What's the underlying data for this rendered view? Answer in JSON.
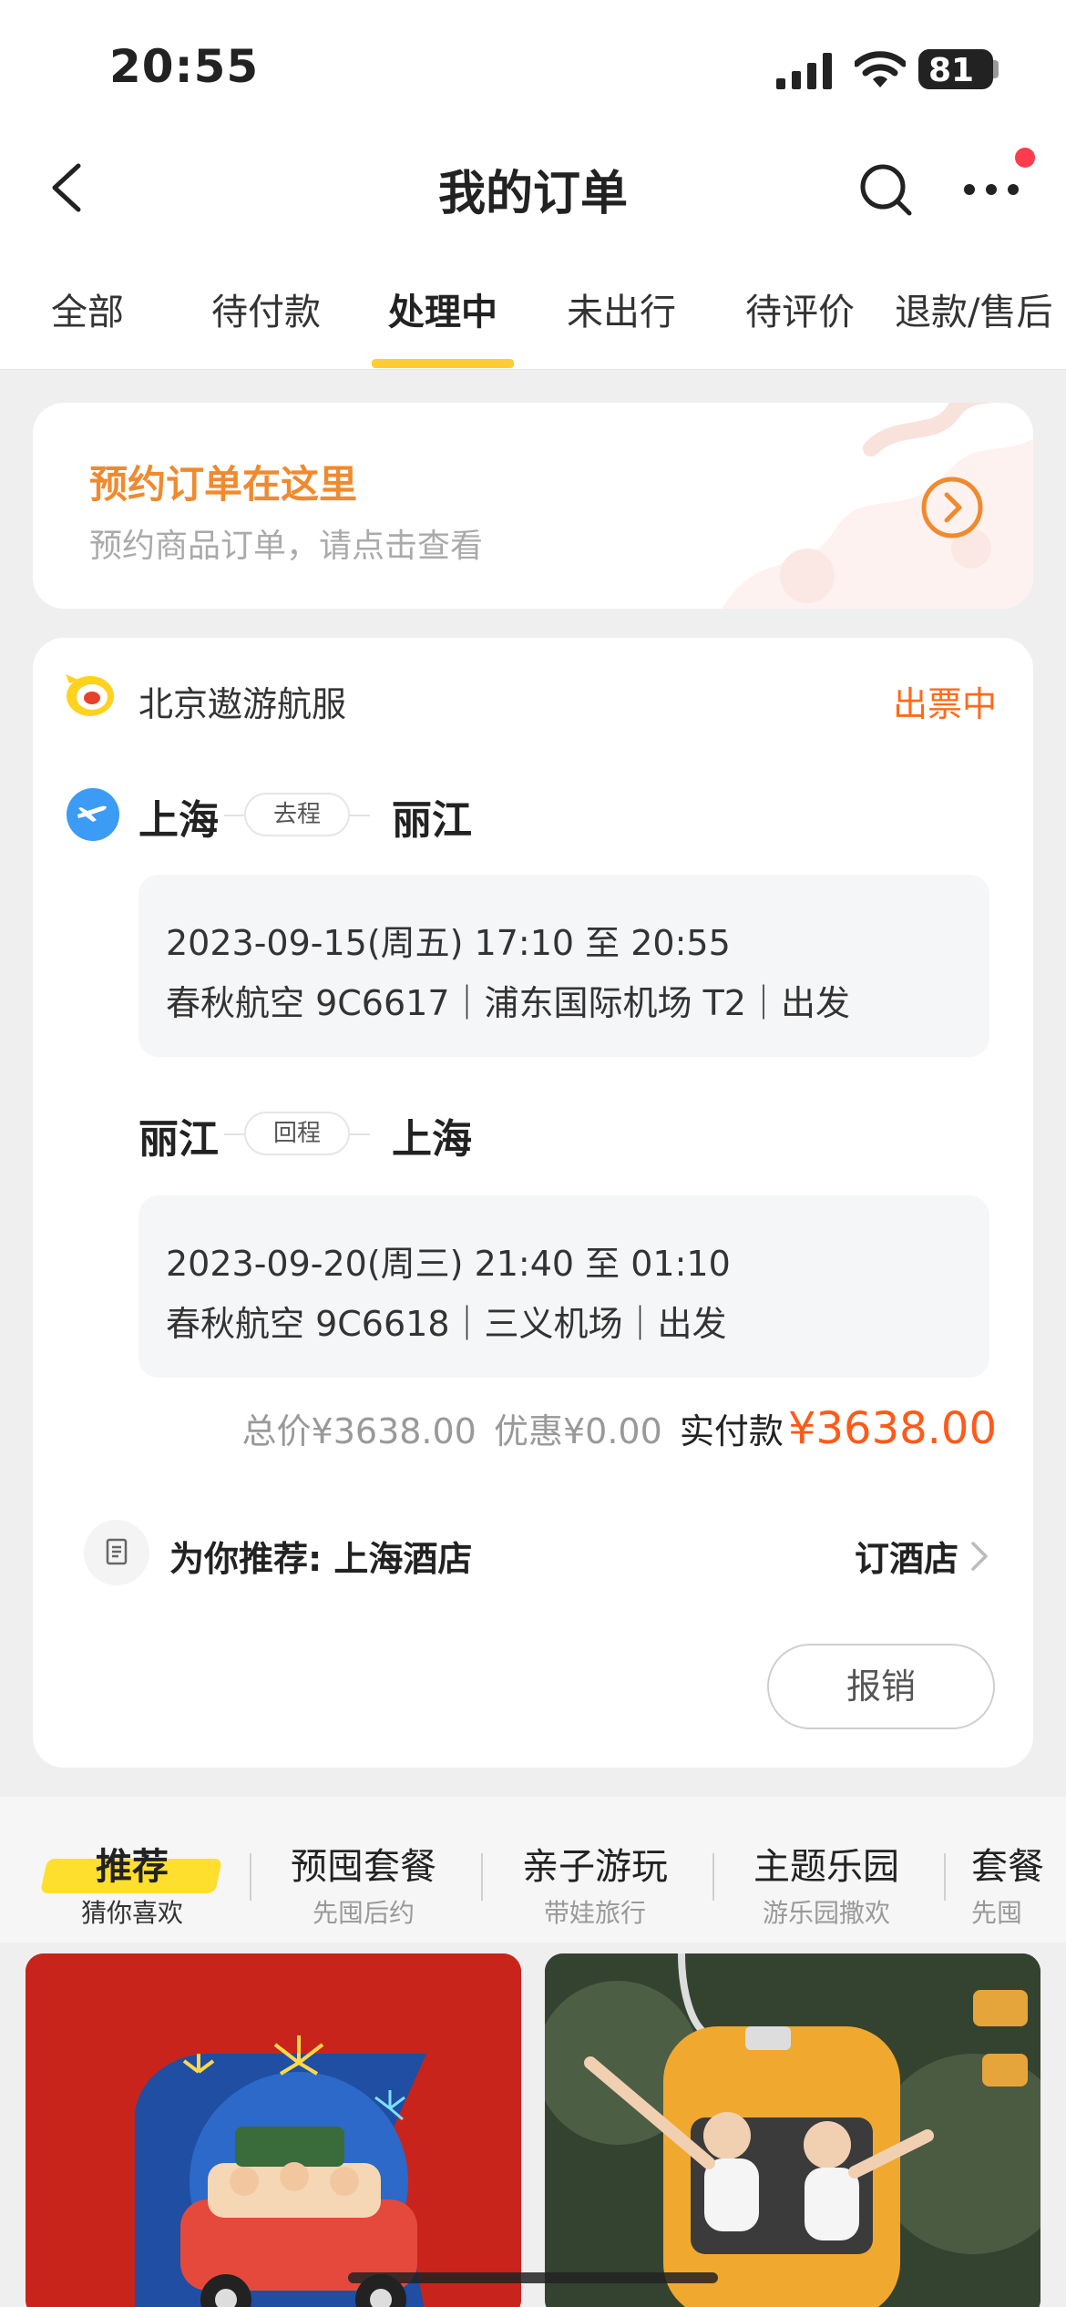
{
  "status_bar": {
    "time": "20:55",
    "battery": "81"
  },
  "nav": {
    "title": "我的订单"
  },
  "tabs": [
    {
      "label": "全部"
    },
    {
      "label": "待付款"
    },
    {
      "label": "处理中"
    },
    {
      "label": "未出行"
    },
    {
      "label": "待评价"
    },
    {
      "label": "退款/售后"
    }
  ],
  "active_tab": "处理中",
  "promo": {
    "title": "预约订单在这里",
    "subtitle": "预约商品订单，请点击查看"
  },
  "order": {
    "airline": "北京遨游航服",
    "status": "出票中",
    "outbound": {
      "from": "上海",
      "tag": "去程",
      "to": "丽江",
      "time": "2023-09-15(周五) 17:10 至 20:55",
      "detail": "春秋航空 9C6617｜浦东国际机场 T2｜出发"
    },
    "return": {
      "from": "丽江",
      "tag": "回程",
      "to": "上海",
      "time": "2023-09-20(周三) 21:40 至 01:10",
      "detail": "春秋航空 9C6618｜三义机场｜出发"
    },
    "total_price": "总价¥3638.00",
    "discount": "优惠¥0.00",
    "paid_label": "实付款",
    "paid_amount": "¥3638.00",
    "recommend_text": "为你推荐: 上海酒店",
    "recommend_action": "订酒店",
    "reimburse_button": "报销"
  },
  "rec_tabs": [
    {
      "title": "推荐",
      "sub": "猜你喜欢"
    },
    {
      "title": "预囤套餐",
      "sub": "先囤后约"
    },
    {
      "title": "亲子游玩",
      "sub": "带娃旅行"
    },
    {
      "title": "主题乐园",
      "sub": "游乐园撒欢"
    },
    {
      "title": "套餐",
      "sub": "先囤"
    }
  ],
  "colors": {
    "accent_yellow": "#ffcc33",
    "status_orange": "#ff6a1a",
    "promo_orange": "#f08a2e",
    "price_red": "#ff5a1a"
  }
}
